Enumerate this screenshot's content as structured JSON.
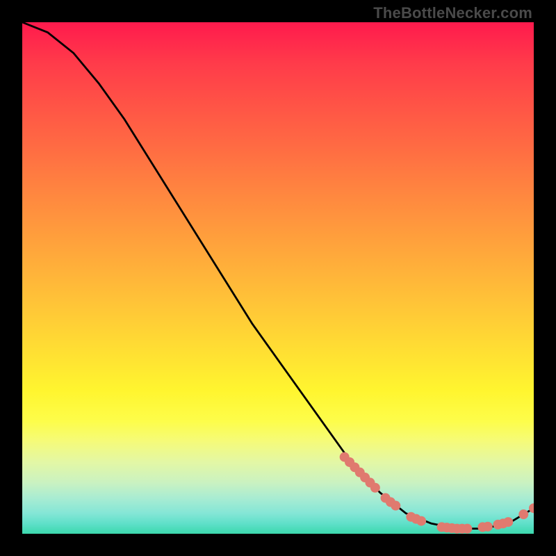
{
  "watermark": "TheBottleNecker.com",
  "chart_data": {
    "type": "line",
    "title": "",
    "xlabel": "",
    "ylabel": "",
    "xlim": [
      0,
      100
    ],
    "ylim": [
      0,
      100
    ],
    "grid": false,
    "legend": false,
    "series": [
      {
        "name": "curve",
        "stroke": "#000000",
        "x": [
          0,
          5,
          10,
          15,
          20,
          25,
          30,
          35,
          40,
          45,
          50,
          55,
          60,
          65,
          70,
          75,
          80,
          85,
          90,
          95,
          100
        ],
        "y": [
          100,
          98,
          94,
          88,
          81,
          73,
          65,
          57,
          49,
          41,
          34,
          27,
          20,
          13,
          8,
          4,
          2,
          1,
          1,
          2,
          5
        ]
      }
    ],
    "markers": [
      {
        "name": "cluster-a",
        "shape": "circle",
        "color": "#e07a6f",
        "x": [
          63,
          64,
          65,
          66,
          67,
          68,
          69
        ],
        "y": [
          15,
          14,
          13,
          12,
          11,
          10,
          9
        ]
      },
      {
        "name": "cluster-b",
        "shape": "circle",
        "color": "#e07a6f",
        "x": [
          71,
          72,
          73
        ],
        "y": [
          7,
          6.2,
          5.5
        ]
      },
      {
        "name": "cluster-c",
        "shape": "circle",
        "color": "#e07a6f",
        "x": [
          76,
          77,
          78
        ],
        "y": [
          3.3,
          2.9,
          2.5
        ]
      },
      {
        "name": "bottom-1",
        "shape": "circle",
        "color": "#e07a6f",
        "x": [
          82,
          83,
          84,
          85,
          86,
          87
        ],
        "y": [
          1.3,
          1.2,
          1.1,
          1.0,
          1.0,
          1.0
        ]
      },
      {
        "name": "bottom-2",
        "shape": "circle",
        "color": "#e07a6f",
        "x": [
          90,
          91
        ],
        "y": [
          1.3,
          1.4
        ]
      },
      {
        "name": "bottom-3",
        "shape": "circle",
        "color": "#e07a6f",
        "x": [
          93,
          94,
          95
        ],
        "y": [
          1.8,
          2.0,
          2.3
        ]
      },
      {
        "name": "tail",
        "shape": "circle",
        "color": "#e07a6f",
        "x": [
          98,
          100
        ],
        "y": [
          3.8,
          5.0
        ]
      }
    ]
  }
}
